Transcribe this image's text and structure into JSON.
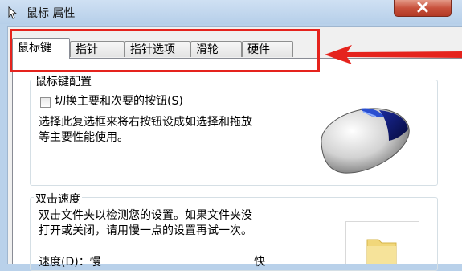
{
  "window": {
    "title": "鼠标 属性",
    "title_icon": "mouse-pointer-icon",
    "close_icon": "close-icon"
  },
  "tabs": [
    {
      "label": "鼠标键",
      "active": true
    },
    {
      "label": "指针",
      "active": false
    },
    {
      "label": "指针选项",
      "active": false
    },
    {
      "label": "滑轮",
      "active": false
    },
    {
      "label": "硬件",
      "active": false
    }
  ],
  "button_config": {
    "title": "鼠标键配置",
    "swap_checkbox_label": "切换主要和次要的按钮(S)",
    "swap_checked": false,
    "description_line1": "选择此复选框来将右按钮设成如选择和拖放",
    "description_line2": "等主要性能使用。"
  },
  "double_click": {
    "title": "双击速度",
    "description_line1": "双击文件夹以检测您的设置。如果文件夹没",
    "description_line2": "打开或关闭，请用慢一点的设置再试一次。",
    "speed_label": "速度(D)：慢",
    "speed_fast_label": "快"
  },
  "colors": {
    "annotation_red": "#e5231d",
    "titlebar": "#b9d1ea"
  }
}
